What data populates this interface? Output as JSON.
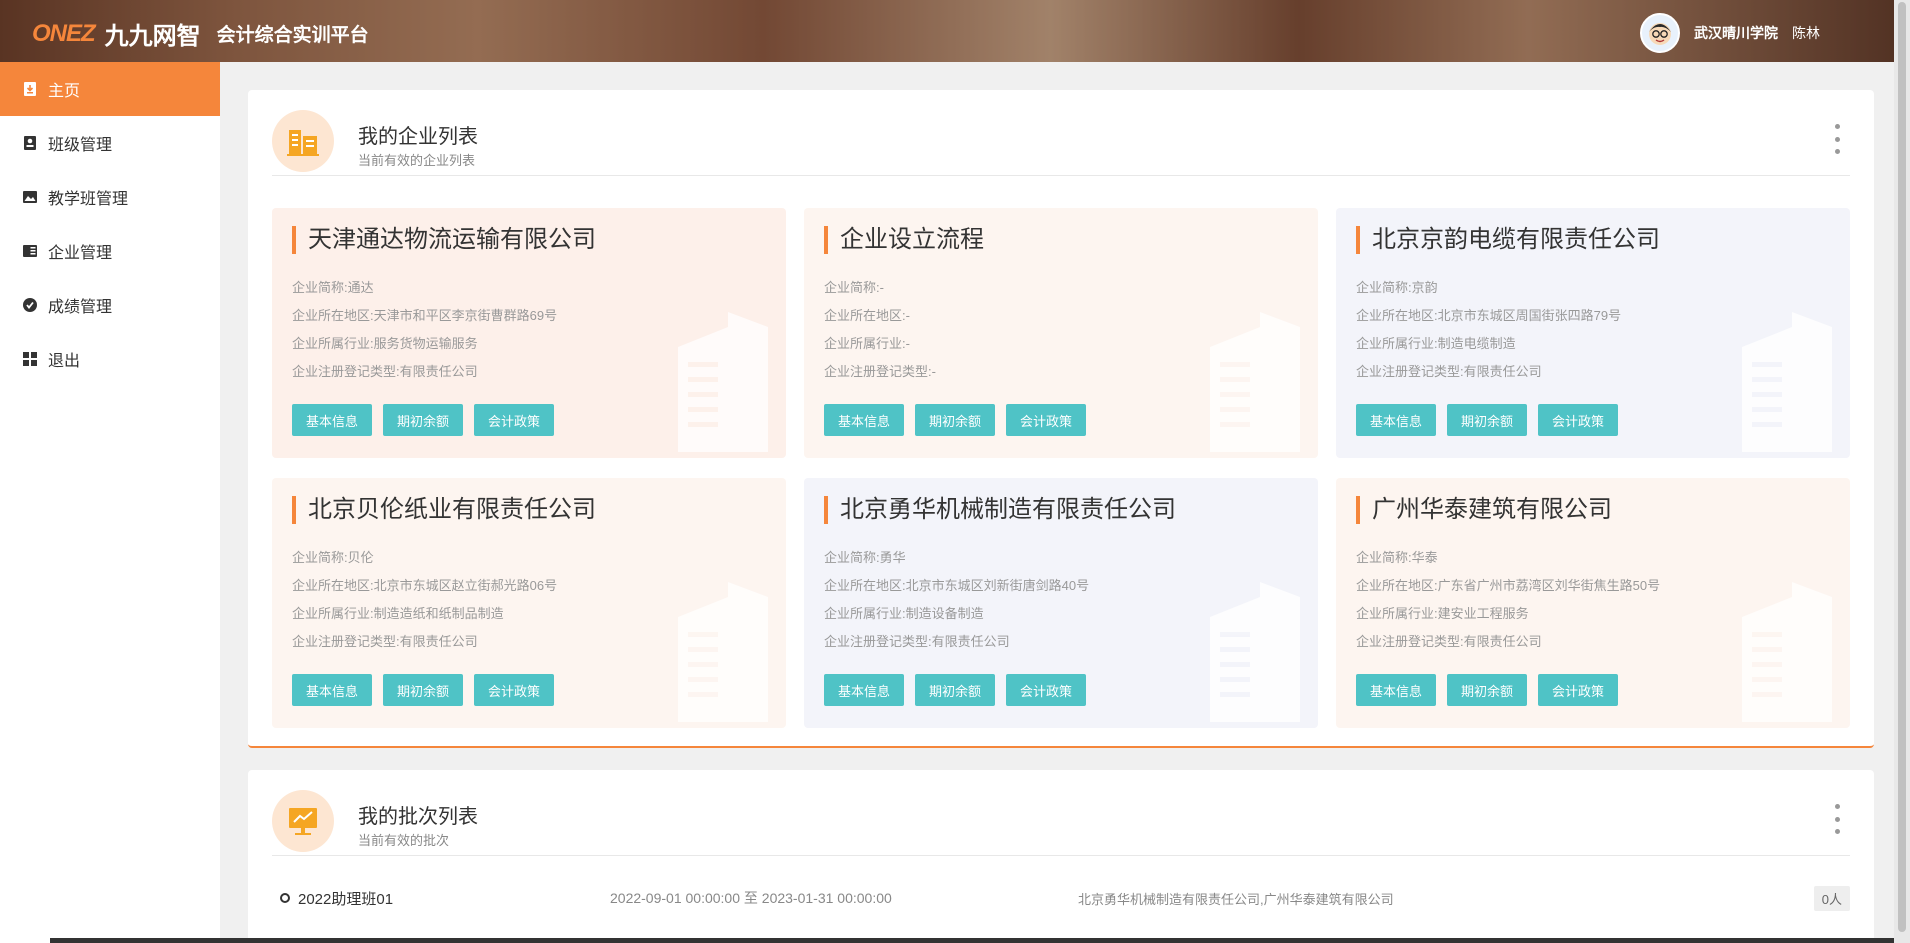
{
  "header": {
    "brand_mark": "ONEZ",
    "brand_cn": "九九网智",
    "platform": "会计综合实训平台",
    "school": "武汉晴川学院",
    "user": "陈林"
  },
  "sidebar": {
    "items": [
      {
        "label": "主页",
        "icon": "home-icon",
        "active": true
      },
      {
        "label": "班级管理",
        "icon": "class-icon"
      },
      {
        "label": "教学班管理",
        "icon": "image-icon"
      },
      {
        "label": "企业管理",
        "icon": "book-icon"
      },
      {
        "label": "成绩管理",
        "icon": "grade-icon"
      },
      {
        "label": "退出",
        "icon": "grid-icon"
      }
    ]
  },
  "companies_panel": {
    "title": "我的企业列表",
    "subtitle": "当前有效的企业列表",
    "buttons": [
      "基本信息",
      "期初余额",
      "会计政策"
    ],
    "cards": [
      {
        "name": "天津通达物流运输有限公司",
        "short": "企业简称:通达",
        "region": "企业所在地区:天津市和平区李京街曹群路69号",
        "industry": "企业所属行业:服务货物运输服务",
        "reg_type": "企业注册登记类型:有限责任公司"
      },
      {
        "name": "企业设立流程",
        "short": "企业简称:-",
        "region": "企业所在地区:-",
        "industry": "企业所属行业:-",
        "reg_type": "企业注册登记类型:-"
      },
      {
        "name": "北京京韵电缆有限责任公司",
        "short": "企业简称:京韵",
        "region": "企业所在地区:北京市东城区周国街张四路79号",
        "industry": "企业所属行业:制造电缆制造",
        "reg_type": "企业注册登记类型:有限责任公司"
      },
      {
        "name": "北京贝伦纸业有限责任公司",
        "short": "企业简称:贝伦",
        "region": "企业所在地区:北京市东城区赵立街郝光路06号",
        "industry": "企业所属行业:制造造纸和纸制品制造",
        "reg_type": "企业注册登记类型:有限责任公司"
      },
      {
        "name": "北京勇华机械制造有限责任公司",
        "short": "企业简称:勇华",
        "region": "企业所在地区:北京市东城区刘新街唐剑路40号",
        "industry": "企业所属行业:制造设备制造",
        "reg_type": "企业注册登记类型:有限责任公司"
      },
      {
        "name": "广州华泰建筑有限公司",
        "short": "企业简称:华泰",
        "region": "企业所在地区:广东省广州市荔湾区刘华街焦生路50号",
        "industry": "企业所属行业:建安业工程服务",
        "reg_type": "企业注册登记类型:有限责任公司"
      }
    ]
  },
  "batches_panel": {
    "title": "我的批次列表",
    "subtitle": "当前有效的批次",
    "rows": [
      {
        "name": "2022助理班01",
        "period": "2022-09-01 00:00:00 至 2023-01-31 00:00:00",
        "companies": "北京勇华机械制造有限责任公司,广州华泰建筑有限公司",
        "count": "0人"
      }
    ]
  },
  "colors": {
    "accent": "#f5863b",
    "button": "#4fc3c6"
  }
}
